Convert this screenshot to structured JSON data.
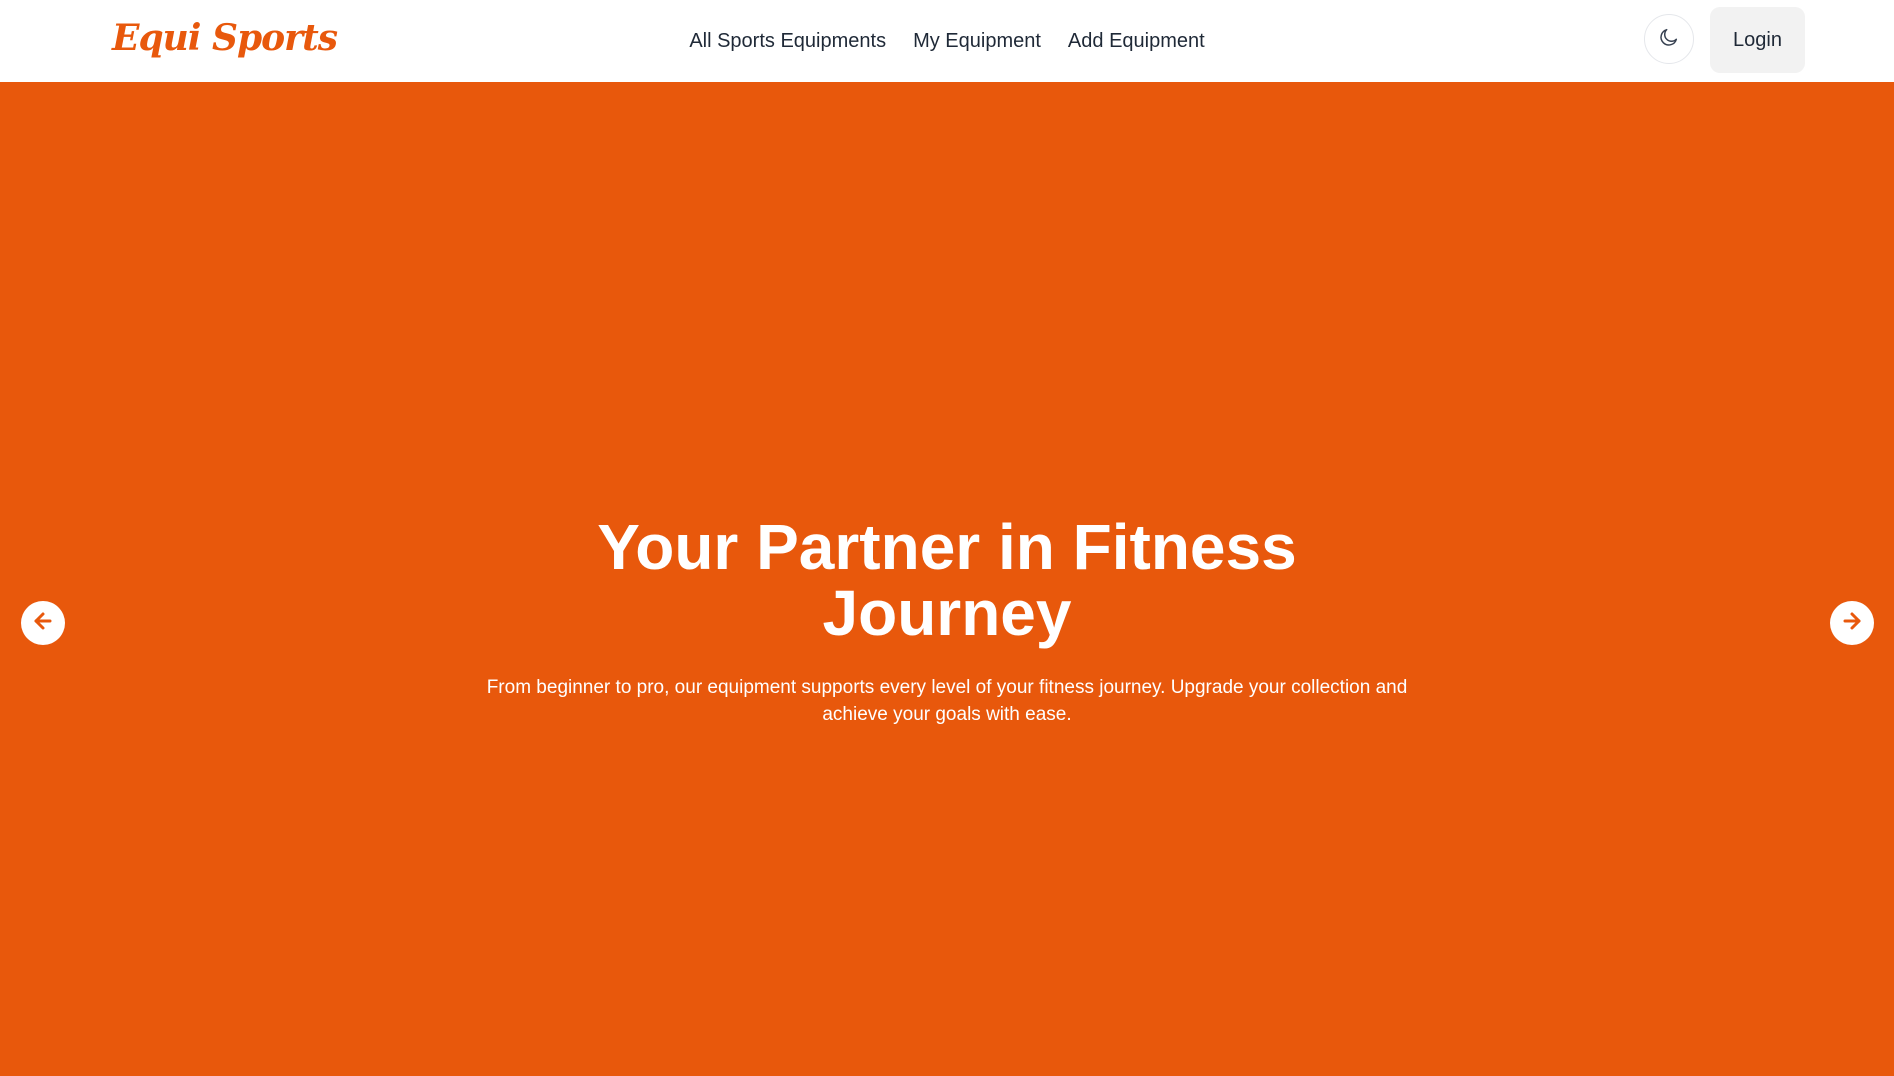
{
  "brand": {
    "name": "Equi Sports"
  },
  "nav": {
    "links": [
      {
        "label": "All Sports Equipments"
      },
      {
        "label": "My Equipment"
      },
      {
        "label": "Add Equipment"
      }
    ]
  },
  "header_actions": {
    "theme_icon": "moon-icon",
    "login_label": "Login"
  },
  "hero": {
    "title": "Your Partner in Fitness Journey",
    "subtitle": "From beginner to pro, our equipment supports every level of your fitness journey. Upgrade your collection and achieve your goals with ease.",
    "prev_icon": "arrow-left-icon",
    "next_icon": "arrow-right-icon"
  },
  "colors": {
    "accent": "#e8580c",
    "text_dark": "#1f2937",
    "login_bg": "#f2f2f2"
  }
}
